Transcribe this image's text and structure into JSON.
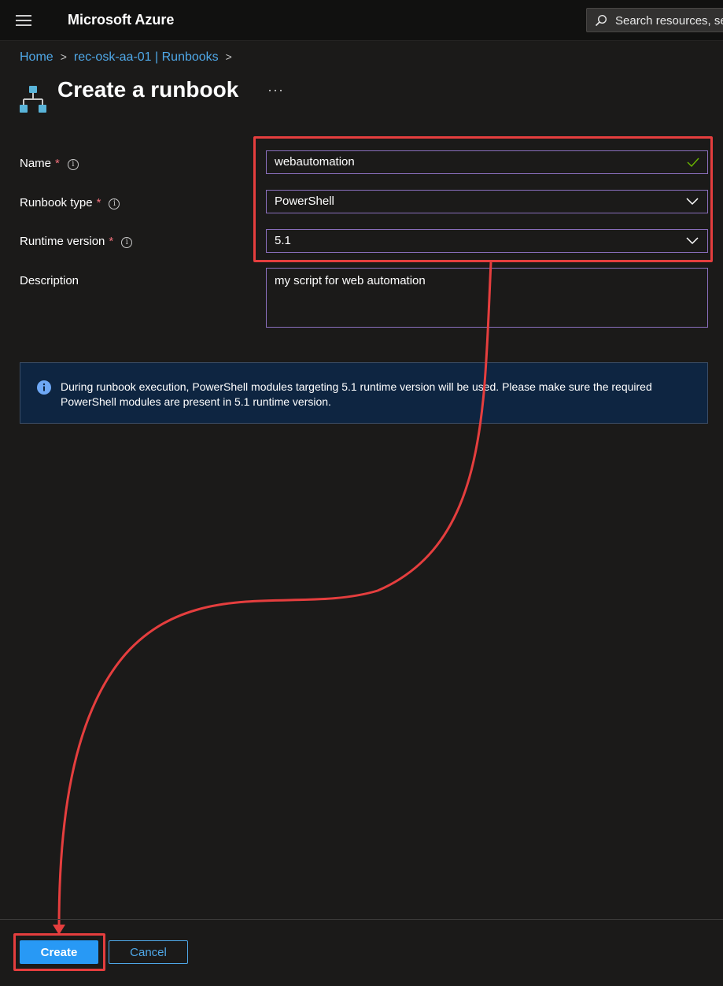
{
  "header": {
    "brand": "Microsoft Azure",
    "search_placeholder": "Search resources, se"
  },
  "breadcrumb": [
    "Home",
    "rec-osk-aa-01 | Runbooks"
  ],
  "page": {
    "title": "Create a runbook",
    "more": "···"
  },
  "form": {
    "name": {
      "label": "Name",
      "required": "*",
      "value": "webautomation"
    },
    "runbook_type": {
      "label": "Runbook type",
      "required": "*",
      "value": "PowerShell"
    },
    "runtime_version": {
      "label": "Runtime version",
      "required": "*",
      "value": "5.1"
    },
    "description": {
      "label": "Description",
      "value": "my script for web automation"
    }
  },
  "banner": {
    "text": "During runbook execution, PowerShell modules targeting 5.1 runtime version will be used. Please make sure the required PowerShell modules are present in 5.1 runtime version."
  },
  "footer": {
    "create_label": "Create",
    "cancel_label": "Cancel"
  },
  "colors": {
    "accent": "#2899f5",
    "link": "#4fa8e8",
    "annotation": "#e53e3e",
    "field_border": "#8a6fbd",
    "banner_bg": "#0e2541"
  }
}
